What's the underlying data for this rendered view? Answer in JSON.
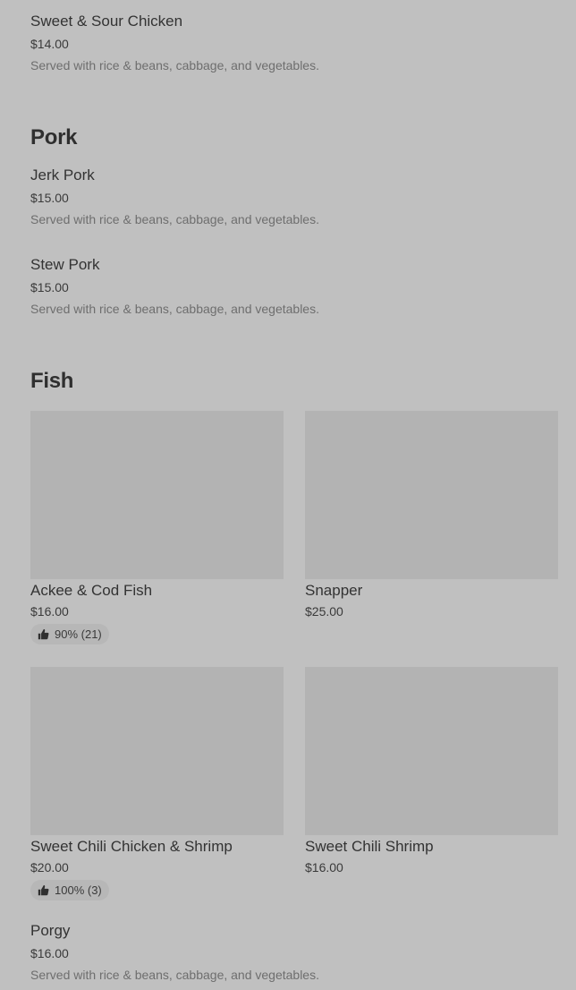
{
  "sections": {
    "chicken_tail": {
      "items": [
        {
          "name": "Sweet & Sour Chicken",
          "price": "$14.00",
          "description": "Served with rice & beans, cabbage, and vegetables."
        }
      ]
    },
    "pork": {
      "title": "Pork",
      "items": [
        {
          "name": "Jerk Pork",
          "price": "$15.00",
          "description": "Served with rice & beans, cabbage, and vegetables."
        },
        {
          "name": "Stew Pork",
          "price": "$15.00",
          "description": "Served with rice & beans, cabbage, and vegetables."
        }
      ]
    },
    "fish": {
      "title": "Fish",
      "cards": [
        {
          "name": "Ackee & Cod Fish",
          "price": "$16.00",
          "rating": "90% (21)"
        },
        {
          "name": "Snapper",
          "price": "$25.00"
        },
        {
          "name": "Sweet Chili Chicken & Shrimp",
          "price": "$20.00",
          "rating": "100% (3)"
        },
        {
          "name": "Sweet Chili Shrimp",
          "price": "$16.00"
        }
      ],
      "items": [
        {
          "name": "Porgy",
          "price": "$16.00",
          "description": "Served with rice & beans, cabbage, and vegetables."
        }
      ]
    }
  },
  "icons": {
    "rating": "thumbs-up-icon"
  },
  "colors": {
    "background": "#c0c0c0",
    "image_placeholder": "#b3b3b3",
    "rating_pill": "#b7b7b7",
    "text_primary": "#333333",
    "text_secondary": "#6e6e6e"
  }
}
